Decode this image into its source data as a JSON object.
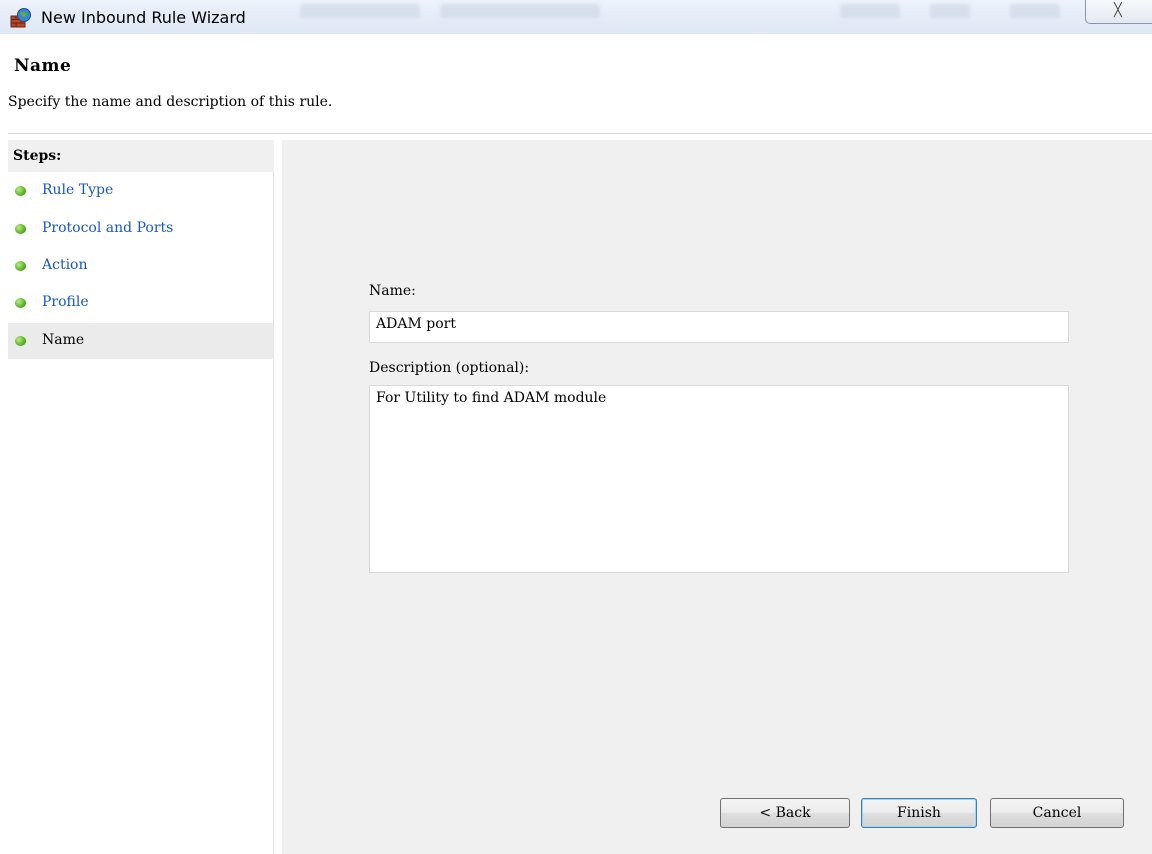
{
  "window": {
    "title": "New Inbound Rule Wizard",
    "close_label": "╳"
  },
  "header": {
    "title": "Name",
    "subtitle": "Specify the name and description of this rule."
  },
  "steps": {
    "heading": "Steps:",
    "items": [
      {
        "label": "Rule Type"
      },
      {
        "label": "Protocol and Ports"
      },
      {
        "label": "Action"
      },
      {
        "label": "Profile"
      },
      {
        "label": "Name"
      }
    ]
  },
  "form": {
    "name_label": "Name:",
    "name_value": "ADAM port",
    "description_label": "Description (optional):",
    "description_value": "For Utility to find ADAM module"
  },
  "buttons": {
    "back": "< Back",
    "finish": "Finish",
    "cancel": "Cancel"
  },
  "colors": {
    "link": "#1a57c4",
    "panel_bg": "#f0f0f0",
    "step_dot": "#5fb82d"
  }
}
